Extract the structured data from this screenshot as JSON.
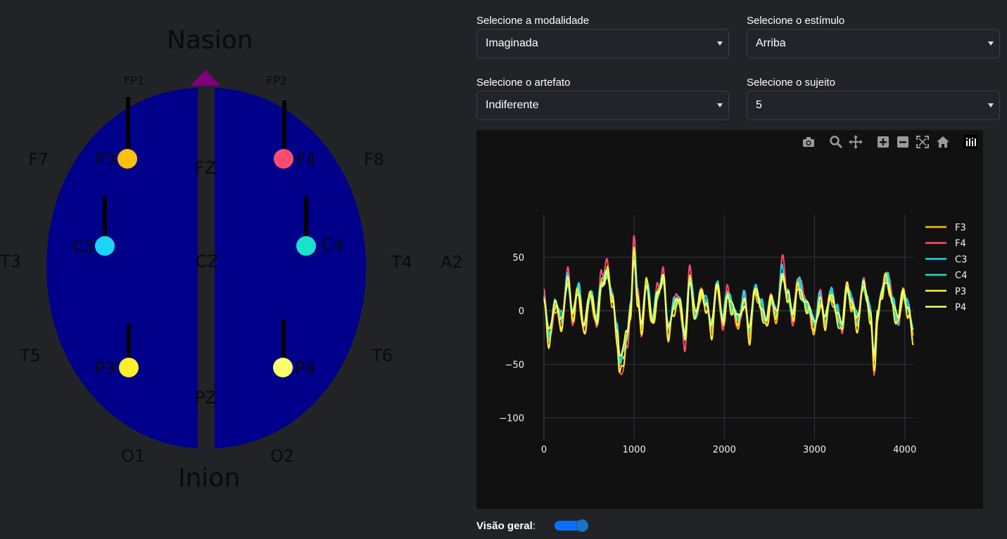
{
  "headmap": {
    "top_label": "Nasion",
    "bottom_label": "Inion",
    "ear_right_label": "A2",
    "colors": {
      "scalp": "#00008b",
      "nose_marker": "#800080",
      "stem": "#000000"
    },
    "static_electrodes": [
      "FP1",
      "FP2",
      "F7",
      "F8",
      "FZ",
      "T3",
      "CZ",
      "T4",
      "T5",
      "T6",
      "PZ",
      "O1",
      "O2"
    ],
    "active_electrodes": [
      {
        "name": "F3",
        "color": "#ffc107"
      },
      {
        "name": "F4",
        "color": "#ff4d6d"
      },
      {
        "name": "C3",
        "color": "#1ad6f5"
      },
      {
        "name": "C4",
        "color": "#18e3c8"
      },
      {
        "name": "P3",
        "color": "#ffef2a"
      },
      {
        "name": "P4",
        "color": "#faff6a"
      }
    ]
  },
  "controls": {
    "modality": {
      "label": "Selecione a modalidade",
      "value": "Imaginada"
    },
    "stimulus": {
      "label": "Selecione o estímulo",
      "value": "Arriba"
    },
    "artifact": {
      "label": "Selecione o artefato",
      "value": "Indiferente"
    },
    "subject": {
      "label": "Selecione o sujeito",
      "value": "5"
    }
  },
  "modebar": [
    "camera-icon",
    "zoom-icon",
    "pan-icon",
    "zoom-in-icon",
    "zoom-out-icon",
    "autoscale-icon",
    "reset-axes-icon",
    "plotly-logo-icon"
  ],
  "chart_data": {
    "type": "line",
    "x_ticks": [
      0,
      1000,
      2000,
      3000,
      4000
    ],
    "y_ticks": [
      50,
      0,
      -50,
      -100
    ],
    "xlim": [
      0,
      4096
    ],
    "ylim": [
      -120,
      90
    ],
    "grid": true,
    "legend_position": "right",
    "background": "#111111",
    "keypoints": {
      "x": [
        0,
        60,
        120,
        200,
        260,
        320,
        380,
        440,
        520,
        580,
        640,
        700,
        760,
        810,
        840,
        880,
        920,
        960,
        1000,
        1040,
        1080,
        1140,
        1200,
        1260,
        1320,
        1380,
        1440,
        1500,
        1560,
        1620,
        1680,
        1740,
        1800,
        1860,
        1920,
        1980,
        2040,
        2100,
        2160,
        2220,
        2280,
        2340,
        2400,
        2460,
        2520,
        2580,
        2640,
        2700,
        2760,
        2820,
        2880,
        2940,
        3000,
        3060,
        3120,
        3180,
        3240,
        3300,
        3360,
        3420,
        3480,
        3540,
        3580,
        3620,
        3660,
        3700,
        3740,
        3800,
        3860,
        3920,
        3980,
        4040,
        4096
      ],
      "y": [
        10,
        -25,
        5,
        -10,
        30,
        -5,
        20,
        -15,
        15,
        -10,
        25,
        35,
        10,
        -20,
        -50,
        -40,
        -25,
        0,
        55,
        10,
        -15,
        25,
        -10,
        15,
        30,
        -20,
        5,
        10,
        -25,
        30,
        -5,
        15,
        5,
        -15,
        25,
        -10,
        15,
        0,
        -10,
        10,
        -20,
        20,
        5,
        -10,
        10,
        -5,
        35,
        15,
        -5,
        25,
        10,
        0,
        -15,
        10,
        -10,
        15,
        0,
        -15,
        20,
        5,
        -10,
        25,
        10,
        -5,
        -45,
        -5,
        15,
        30,
        10,
        -10,
        15,
        0,
        -20
      ]
    },
    "series": [
      {
        "name": "F3",
        "color": "#ffc107",
        "scale": 1.05,
        "offset": -2,
        "jitter": 4
      },
      {
        "name": "F4",
        "color": "#ff4d6d",
        "scale": 1.3,
        "offset": 0,
        "jitter": 5
      },
      {
        "name": "C3",
        "color": "#1ad6f5",
        "scale": 1.0,
        "offset": 3,
        "jitter": 4
      },
      {
        "name": "C4",
        "color": "#18e3c8",
        "scale": 0.95,
        "offset": 1,
        "jitter": 3
      },
      {
        "name": "P3",
        "color": "#ffef2a",
        "scale": 1.1,
        "offset": -3,
        "jitter": 5
      },
      {
        "name": "P4",
        "color": "#faff6a",
        "scale": 0.9,
        "offset": 2,
        "jitter": 3
      }
    ]
  },
  "overview": {
    "label": "Visão geral",
    "colon": ":",
    "enabled": true
  }
}
